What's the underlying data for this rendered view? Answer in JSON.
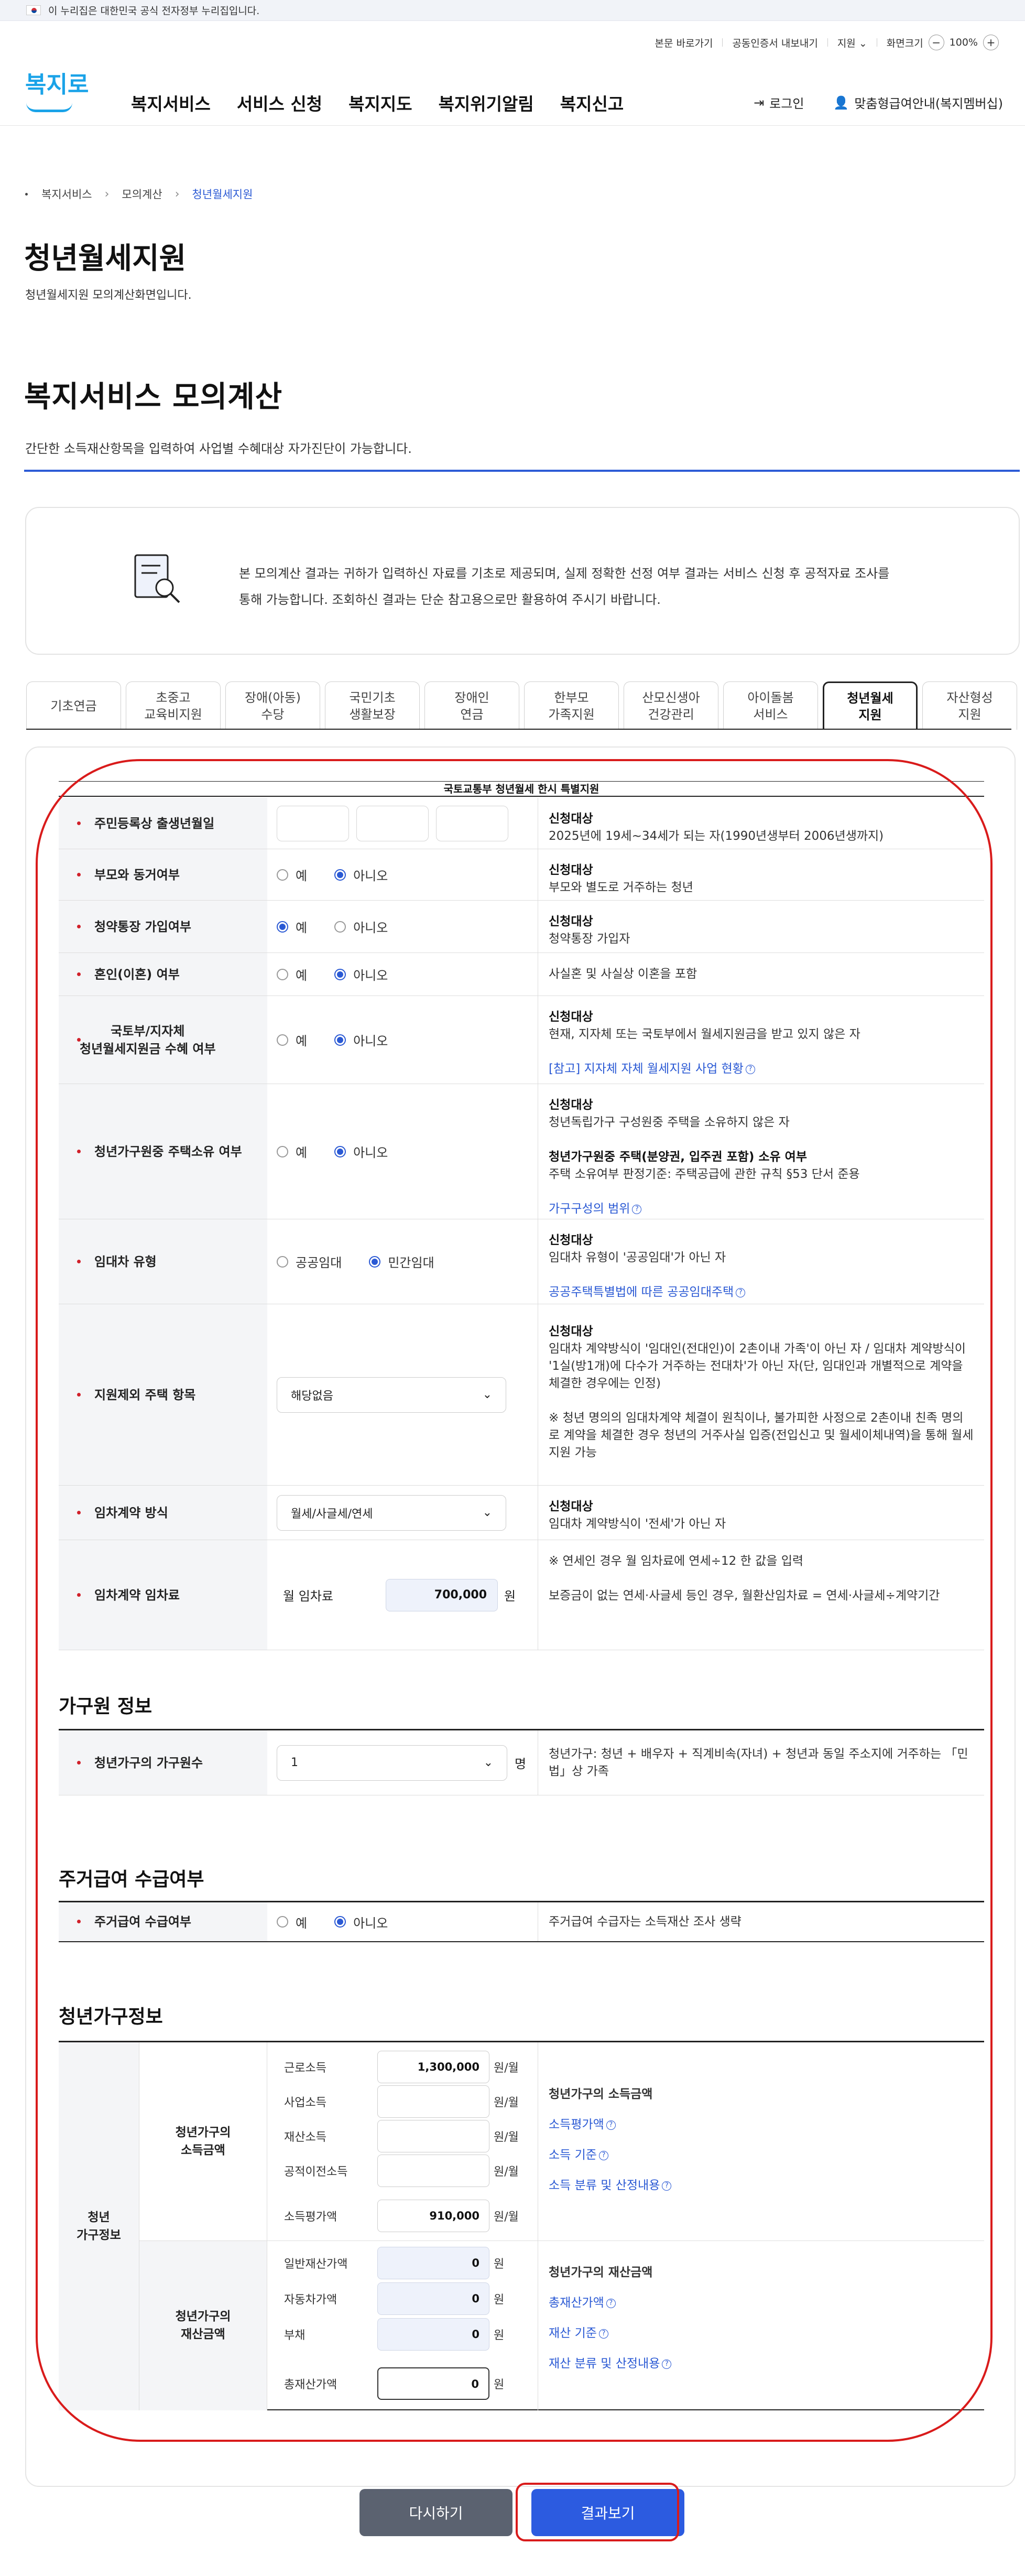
{
  "gov_bar": {
    "text": "이 누리집은 대한민국 공식 전자정부 누리집입니다."
  },
  "util": {
    "skip": "본문 바로가기",
    "cert": "공동인증서 내보내기",
    "region": "지원",
    "zoom_label": "화면크기",
    "zoom": "100%"
  },
  "logo": {
    "text": "복지로"
  },
  "gnb": [
    "복지서비스",
    "서비스 신청",
    "복지지도",
    "복지위기알림",
    "복지신고"
  ],
  "member": {
    "login": "로그인",
    "custom": "맞춤형급여안내(복지멤버십)"
  },
  "breadcrumb": [
    "복지서비스",
    "모의계산",
    "청년월세지원"
  ],
  "page": {
    "title": "청년월세지원",
    "desc": "청년월세지원 모의계산화면입니다."
  },
  "section": {
    "title": "복지서비스 모의계산",
    "desc": "간단한 소득재산항목을 입력하여 사업별 수혜대상 자가진단이 가능합니다."
  },
  "notice": {
    "text": "본 모의계산 결과는 귀하가 입력하신 자료를 기초로 제공되며, 실제 정확한 선정 여부 결과는 서비스 신청 후 공적자료 조사를 통해 가능합니다. 조회하신 결과는 단순 참고용으로만 활용하여 주시기 바랍니다."
  },
  "tabs": [
    "기초연금",
    "초중고\n교육비지원",
    "장애(아동)\n수당",
    "국민기초\n생활보장",
    "장애인\n연금",
    "한부모\n가족지원",
    "산모신생아\n건강관리",
    "아이돌봄\n서비스",
    "청년월세\n지원",
    "자산형성\n지원"
  ],
  "active_tab": "청년월세\n지원",
  "table_caption": "국토교통부 청년월세 한시 특별지원",
  "options": {
    "yes": "예",
    "no": "아니오",
    "public": "공공임대",
    "private": "민간임대"
  },
  "rows": {
    "birth": {
      "label": "주민등록상 출생년월일",
      "t1": "신청대상",
      "t2": "2025년에 19세~34세가 되는 자(1990년생부터 2006년생까지)"
    },
    "parents": {
      "label": "부모와 동거여부",
      "t1": "신청대상",
      "t2": "부모와 별도로 거주하는 청년"
    },
    "savings": {
      "label": "청약통장 가입여부",
      "t1": "신청대상",
      "t2": "청약통장 가입자"
    },
    "marriage": {
      "label": "혼인(이혼) 여부",
      "t2": "사실혼 및 사실상 이혼을 포함"
    },
    "subsidy": {
      "label": "국토부/지자체\n청년월세지원금 수혜 여부",
      "t1": "신청대상",
      "t2": "현재, 지자체 또는 국토부에서 월세지원금을 받고 있지 않은 자",
      "link": "[참고] 지자체 자체 월세지원 사업 현황"
    },
    "house": {
      "label": "청년가구원중 주택소유 여부",
      "t1": "신청대상",
      "t2": "청년독립가구 구성원중 주택을 소유하지 않은 자",
      "t3": "청년가구원중 주택(분양권, 입주권 포함) 소유 여부",
      "t4": "주택 소유여부 판정기준: 주택공급에 관한 규칙 §53 단서 준용",
      "link": "가구구성의 범위"
    },
    "lease_type": {
      "label": "임대차 유형",
      "t1": "신청대상",
      "t2": "임대차 유형이 '공공임대'가 아닌 자",
      "link": "공공주택특별법에 따른 공공임대주택"
    },
    "excluded": {
      "label": "지원제외 주택 항목",
      "select": "해당없음",
      "t1": "신청대상",
      "t2": "임대차 계약방식이 '임대인(전대인)이 2촌이내 가족'이 아닌 자 / 임대차 계약방식이 '1실(방1개)에 다수가 거주하는 전대차'가 아닌 자(단, 임대인과 개별적으로 계약을 체결한 경우에는 인정)",
      "t3": "※ 청년 명의의 임대차계약 체결이 원칙이나, 불가피한 사정으로 2촌이내 친족 명의로 계약을 체결한 경우 청년의 거주사실 입증(전입신고 및 월세이체내역)을 통해 월세지원 가능"
    },
    "contract": {
      "label": "임차계약 방식",
      "select": "월세/사글세/연세",
      "t1": "신청대상",
      "t2": "임대차 계약방식이 '전세'가 아닌 자"
    },
    "rent": {
      "label": "임차계약 임차료",
      "sub": "월 임차료",
      "value": "700,000",
      "unit": "원",
      "t1": "※ 연세인 경우 월 임차료에 연세÷12 한 값을 입력",
      "t2": "보증금이 없는 연세·사글세 등인 경우, 월환산임차료 = 연세·사글세÷계약기간"
    }
  },
  "household": {
    "title": "가구원 정보",
    "label": "청년가구의 가구원수",
    "value": "1",
    "unit": "명",
    "info": "청년가구: 청년 + 배우자 + 직계비속(자녀) + 청년과 동일 주소지에 거주하는 「민법」상 가족"
  },
  "housing_benefit": {
    "title": "주거급여 수급여부",
    "label": "주거급여 수급여부",
    "info": "주거급여 수급자는 소득재산 조사 생략"
  },
  "youth": {
    "title": "청년가구정보",
    "col1": "청년\n가구정보",
    "income_label": "청년가구의\n소득금액",
    "asset_label": "청년가구의\n재산금액",
    "income_rows": [
      {
        "name": "근로소득",
        "value": "1,300,000",
        "unit": "원/월"
      },
      {
        "name": "사업소득",
        "value": "",
        "unit": "원/월"
      },
      {
        "name": "재산소득",
        "value": "",
        "unit": "원/월"
      },
      {
        "name": "공적이전소득",
        "value": "",
        "unit": "원/월"
      },
      {
        "name": "소득평가액",
        "value": "910,000",
        "unit": "원/월"
      }
    ],
    "asset_rows": [
      {
        "name": "일반재산가액",
        "value": "0",
        "unit": "원"
      },
      {
        "name": "자동차가액",
        "value": "0",
        "unit": "원"
      },
      {
        "name": "부채",
        "value": "0",
        "unit": "원"
      },
      {
        "name": "총재산가액",
        "value": "0",
        "unit": "원"
      }
    ],
    "income_info": {
      "title": "청년가구의 소득금액",
      "l1": "소득평가액",
      "l2": "소득 기준",
      "l3": "소득 분류 및 산정내용"
    },
    "asset_info": {
      "title": "청년가구의 재산금액",
      "l1": "총재산가액",
      "l2": "재산 기준",
      "l3": "재산 분류 및 산정내용"
    }
  },
  "buttons": {
    "reset": "다시하기",
    "result": "결과보기"
  },
  "colors": {
    "accent": "#2a59d4",
    "required": "#d1202a",
    "annotation": "#d91b1b"
  }
}
